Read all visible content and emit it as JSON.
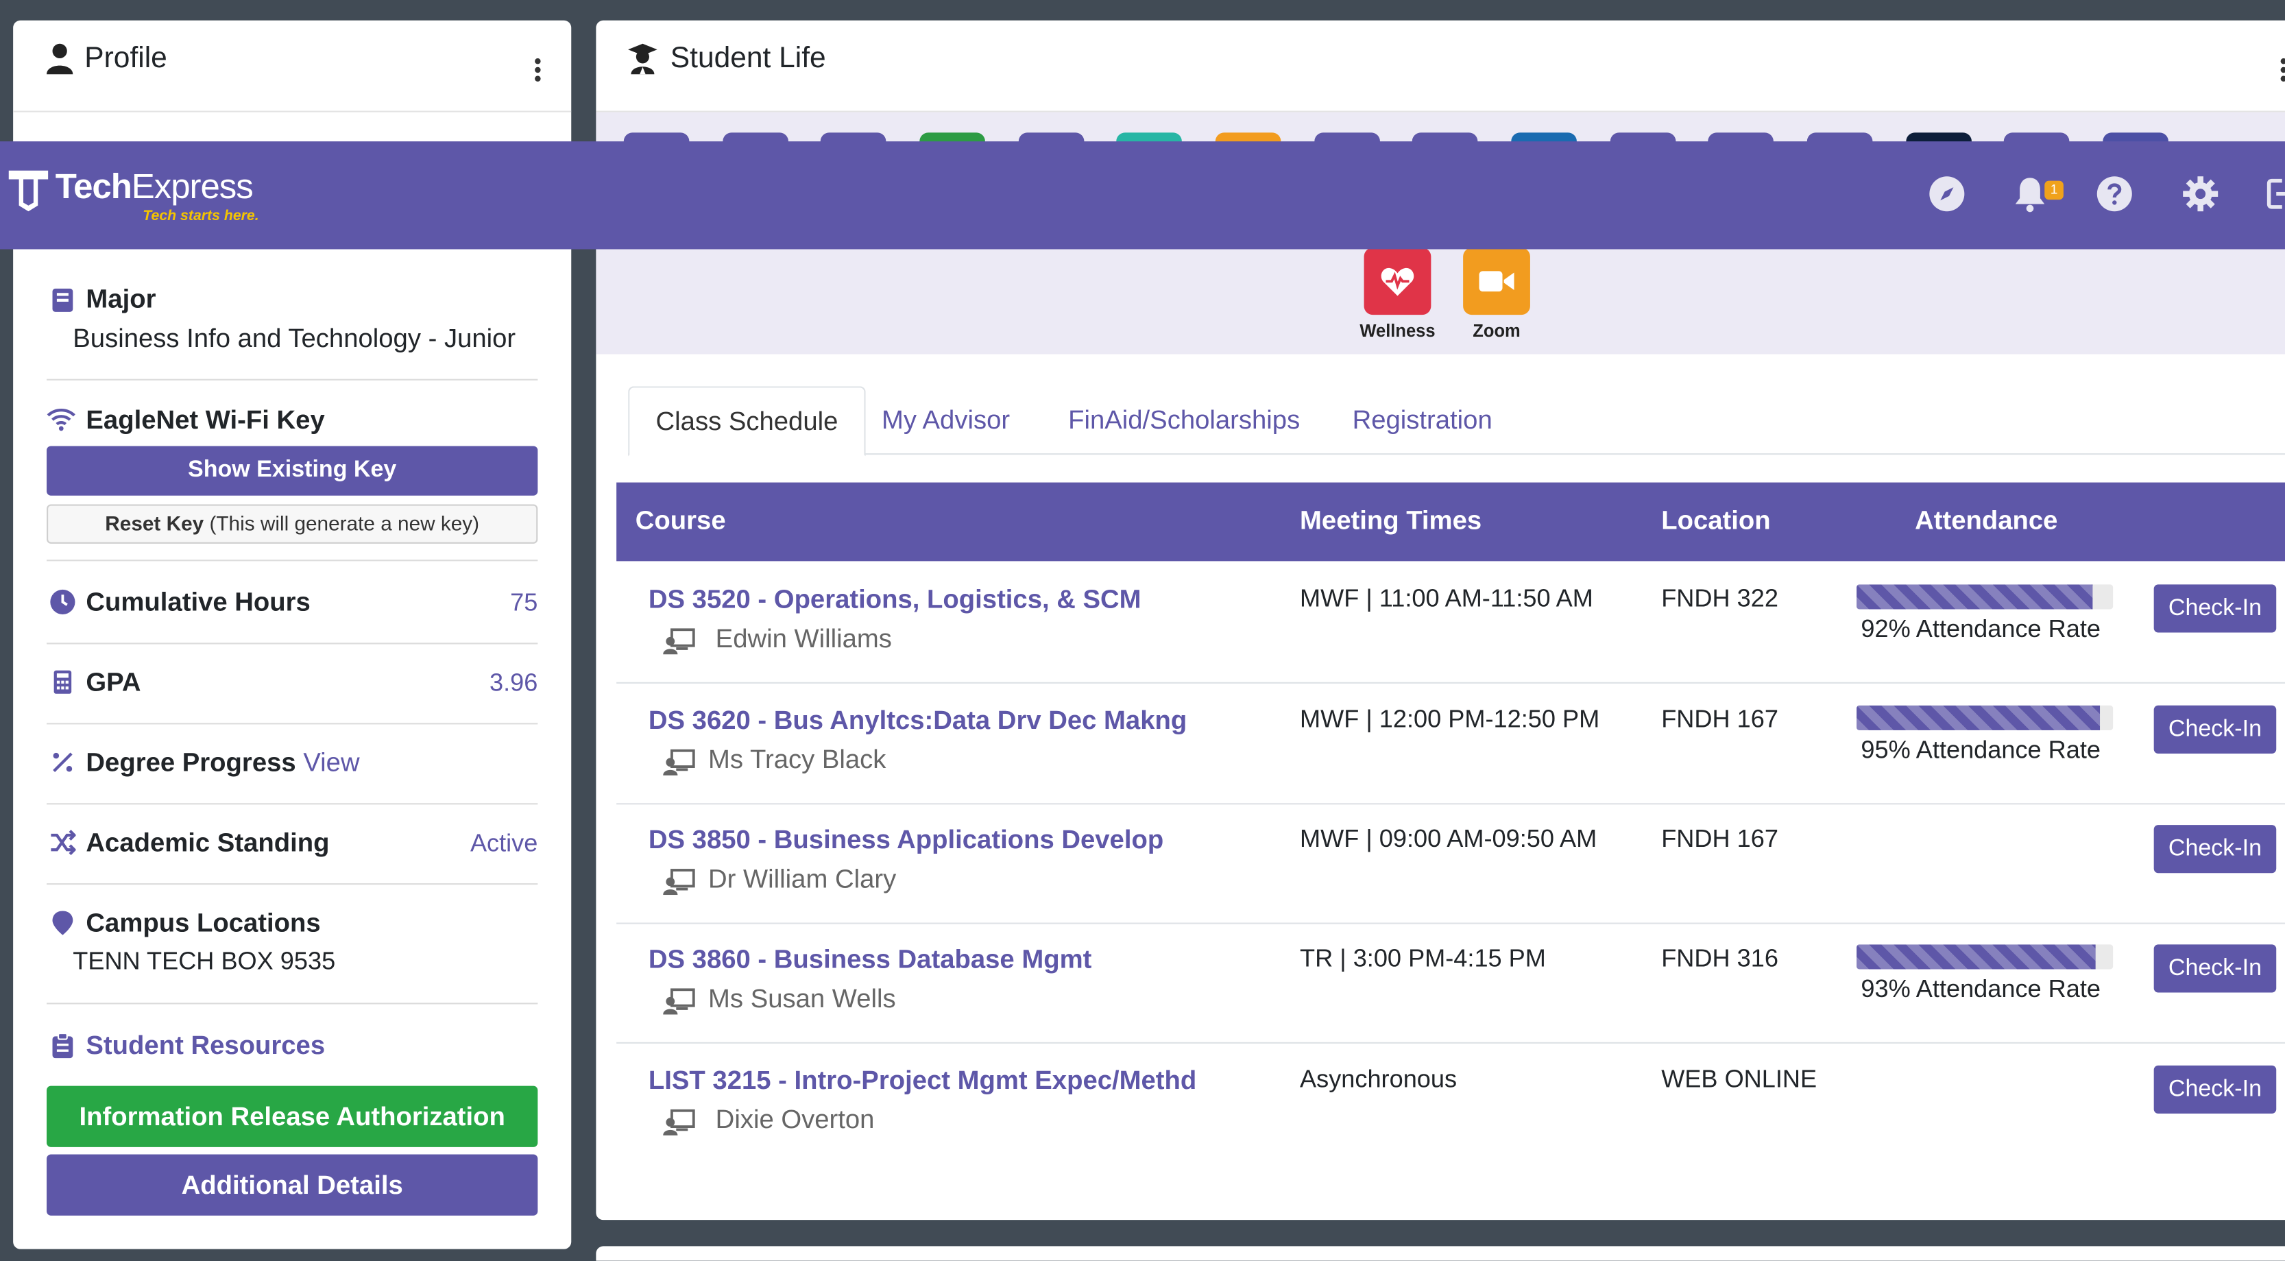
{
  "topbar": {
    "logo_tech": "Tech",
    "logo_express": "Express",
    "tagline": "Tech starts here.",
    "notification_count": "1",
    "icons": [
      "compass-icon",
      "bell-icon",
      "help-icon",
      "gear-icon",
      "logout-icon"
    ]
  },
  "profile": {
    "title": "Profile",
    "major_label": "Major",
    "major_value": "Business Info and Technology - Junior",
    "wifi_label": "EagleNet Wi-Fi Key",
    "show_key": "Show Existing Key",
    "reset_key_bold": "Reset Key",
    "reset_key_note": "(This will generate a new key)",
    "hours_label": "Cumulative Hours",
    "hours_value": "75",
    "gpa_label": "GPA",
    "gpa_value": "3.96",
    "degree_label": "Degree Progress",
    "degree_link": "View",
    "standing_label": "Academic Standing",
    "standing_value": "Active",
    "campus_label": "Campus Locations",
    "campus_value": "TENN TECH BOX 9535",
    "resources_label": "Student Resources",
    "info_release": "Information Release Authorization",
    "additional": "Additional Details"
  },
  "student_life": {
    "title": "Student Life",
    "apps": [
      {
        "label": "Wellness",
        "color": "#e03448",
        "icon": "heart-pulse-icon"
      },
      {
        "label": "Zoom",
        "color": "#f29c1f",
        "icon": "video-camera-icon"
      }
    ],
    "tabs": [
      "Class Schedule",
      "My Advisor",
      "FinAid/Scholarships",
      "Registration"
    ],
    "table_headers": {
      "course": "Course",
      "meeting": "Meeting Times",
      "location": "Location",
      "attendance": "Attendance"
    },
    "check_in_label": "Check-In",
    "courses": [
      {
        "course": "DS 3520 - Operations, Logistics, & SCM",
        "instructor": "Edwin Williams",
        "meeting": "MWF | 11:00 AM-11:50 AM",
        "location": "FNDH 322",
        "attendance": 92,
        "attendance_text": "92% Attendance Rate"
      },
      {
        "course": "DS 3620 - Bus Anyltcs:Data Drv Dec Makng",
        "instructor": "Ms Tracy Black",
        "meeting": "MWF | 12:00 PM-12:50 PM",
        "location": "FNDH 167",
        "attendance": 95,
        "attendance_text": "95% Attendance Rate"
      },
      {
        "course": "DS 3850 - Business Applications Develop",
        "instructor": "Dr William Clary",
        "meeting": "MWF | 09:00 AM-09:50 AM",
        "location": "FNDH 167",
        "attendance": null,
        "attendance_text": ""
      },
      {
        "course": "DS 3860 - Business Database Mgmt",
        "instructor": "Ms Susan Wells",
        "meeting": "TR | 3:00 PM-4:15 PM",
        "location": "FNDH 316",
        "attendance": 93,
        "attendance_text": "93% Attendance Rate"
      },
      {
        "course": "LIST 3215 - Intro-Project Mgmt Expec/Methd",
        "instructor": "Dixie Overton",
        "meeting": "Asynchronous",
        "location": "WEB ONLINE",
        "attendance": null,
        "attendance_text": ""
      }
    ]
  }
}
